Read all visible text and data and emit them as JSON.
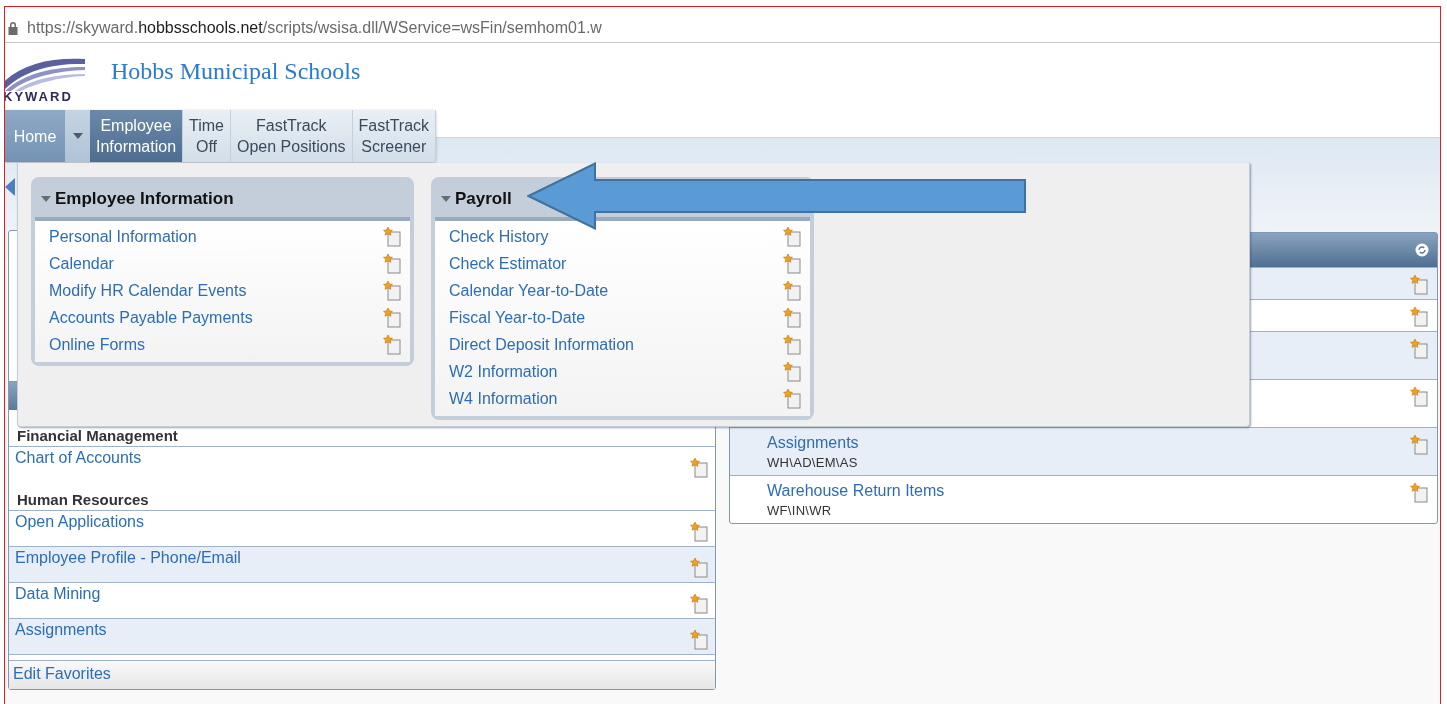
{
  "url": {
    "text": "https://skyward.**hobbsschools.net**/scripts/wsisa.dll/WService=wsFin/semhom01.w"
  },
  "logo": {
    "text": "KYWARD"
  },
  "site_title": "Hobbs Municipal Schools",
  "nav": [
    {
      "kind": "home",
      "label": "Home",
      "selected": false
    },
    {
      "kind": "caret",
      "selected": false
    },
    {
      "kind": "tab",
      "label": "Employee\nInformation",
      "selected": true
    },
    {
      "kind": "tab",
      "label": "Time\nOff",
      "selected": false
    },
    {
      "kind": "tab",
      "label": "FastTrack\nOpen Positions",
      "selected": false
    },
    {
      "kind": "tab",
      "label": "FastTrack\nScreener",
      "selected": false
    }
  ],
  "menu": {
    "sections": [
      {
        "title": "Employee Information",
        "expanded": true,
        "items": [
          "Personal Information",
          "Calendar",
          "Modify HR Calendar Events",
          "Accounts Payable Payments",
          "Online Forms"
        ]
      },
      {
        "title": "Payroll",
        "expanded": true,
        "items": [
          "Check History",
          "Check Estimator",
          "Calendar Year-to-Date",
          "Fiscal Year-to-Date",
          "Direct Deposit Information",
          "W2 Information",
          "W4 Information"
        ]
      }
    ]
  },
  "left_widget": {
    "groups": [
      {
        "heading": "Financial Management",
        "items": [
          "Chart of Accounts"
        ]
      },
      {
        "heading": "Human Resources",
        "items": [
          "Open Applications",
          "Employee Profile - Phone/Email",
          "Data Mining",
          "Assignments"
        ]
      }
    ],
    "footer": "Edit Favorites"
  },
  "right_widget": {
    "rows": [
      {
        "kind": "short"
      },
      {
        "kind": "short"
      },
      {
        "kind": "tall"
      },
      {
        "kind": "tall"
      },
      {
        "kind": "tall",
        "title": "Assignments",
        "code": "WH\\AD\\EM\\AS"
      },
      {
        "kind": "tall",
        "title": "Warehouse Return Items",
        "code": "WF\\IN\\WR"
      }
    ]
  }
}
